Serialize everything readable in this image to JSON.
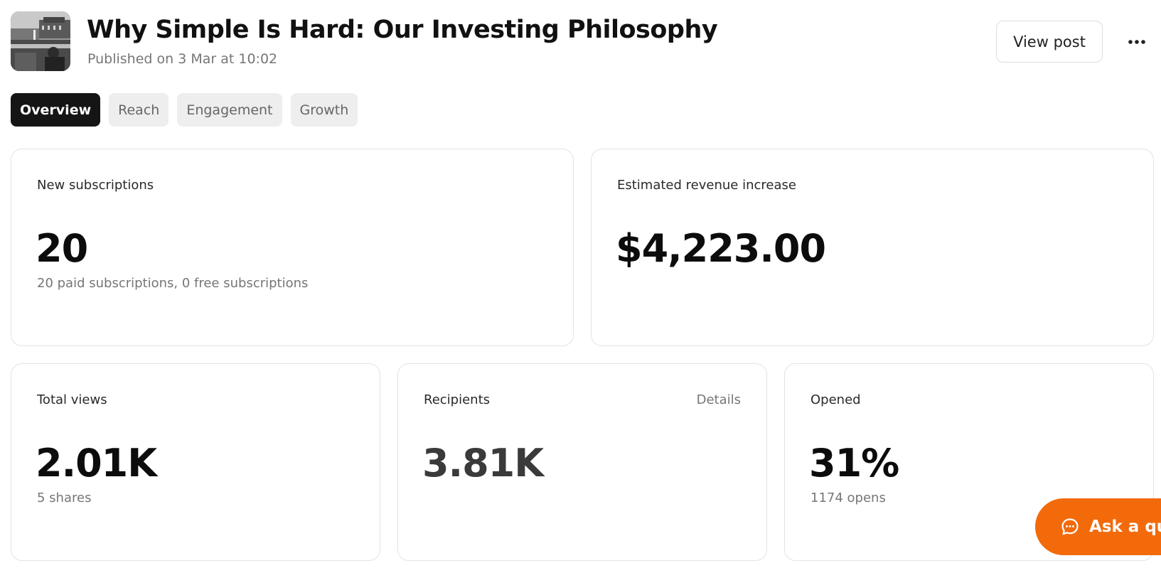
{
  "header": {
    "title": "Why Simple Is Hard: Our Investing Philosophy",
    "published": "Published on 3 Mar at 10:02",
    "view_post_label": "View post",
    "more_icon": "more-horizontal-icon"
  },
  "tabs": [
    {
      "label": "Overview",
      "active": true
    },
    {
      "label": "Reach",
      "active": false
    },
    {
      "label": "Engagement",
      "active": false
    },
    {
      "label": "Growth",
      "active": false
    }
  ],
  "stats": {
    "new_subscriptions": {
      "label": "New subscriptions",
      "value": "20",
      "sub": "20 paid subscriptions, 0 free subscriptions"
    },
    "revenue": {
      "label": "Estimated revenue increase",
      "value": "$4,223.00"
    },
    "total_views": {
      "label": "Total views",
      "value": "2.01K",
      "sub": "5 shares"
    },
    "recipients": {
      "label": "Recipients",
      "value": "3.81K",
      "details_label": "Details"
    },
    "opened": {
      "label": "Opened",
      "value": "31%",
      "sub": "1174 opens"
    }
  },
  "ask_button": {
    "label": "Ask a qu",
    "icon": "chat-bubble-icon"
  },
  "colors": {
    "accent": "#f26a0a",
    "active_tab": "#151515",
    "tab_bg": "#eeeeee",
    "muted_text": "#767676"
  }
}
